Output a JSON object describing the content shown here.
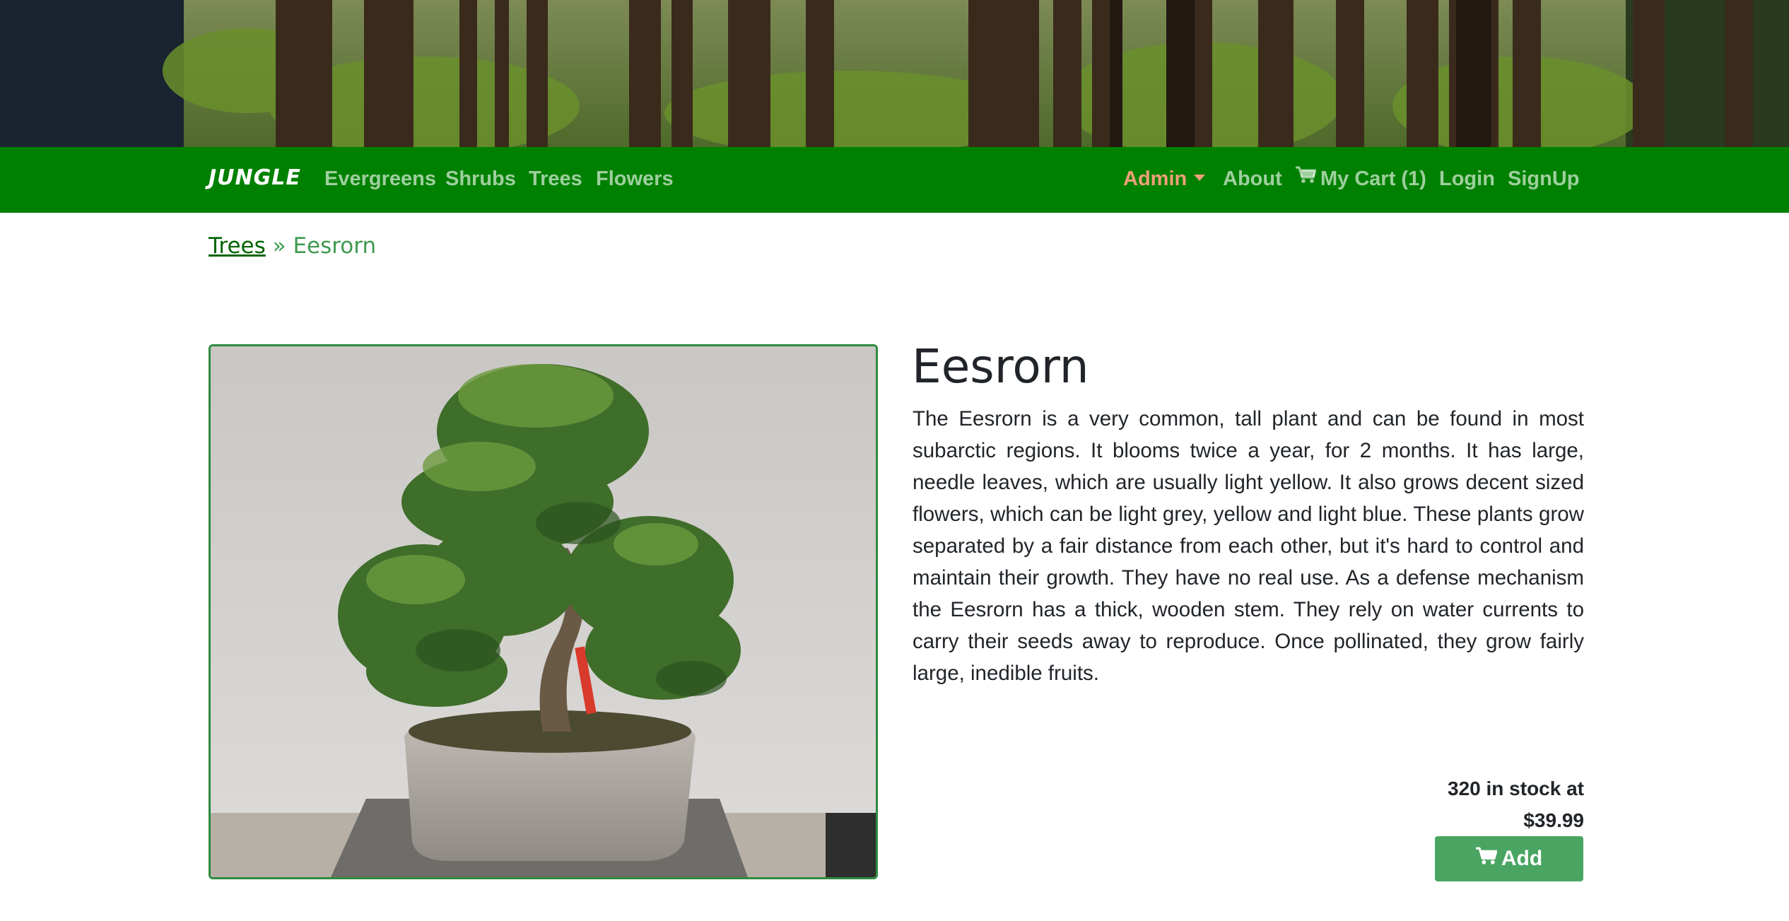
{
  "navbar": {
    "brand": "JUNGLE",
    "left_links": [
      "Evergreens",
      "Shrubs",
      "Trees",
      "Flowers"
    ],
    "admin_label": "Admin",
    "about_label": "About",
    "cart_label": "My Cart (1)",
    "login_label": "Login",
    "signup_label": "SignUp"
  },
  "breadcrumb": {
    "parent": "Trees",
    "separator": "»",
    "current": "Eesrorn"
  },
  "product": {
    "name": "Eesrorn",
    "description": "The Eesrorn is a very common, tall plant and can be found in most subarctic regions. It blooms twice a year, for 2 months. It has large, needle leaves, which are usually light yellow. It also grows decent sized flowers, which can be light grey, yellow and light blue. These plants grow separated by a fair distance from each other, but it's hard to control and maintain their growth. They have no real use. As a defense mechanism the Eesrorn has a thick, wooden stem. They rely on water currents to carry their seeds away to reproduce. Once pollinated, they grow fairly large, inedible fruits.",
    "stock_text": "320 in stock at",
    "price": "$39.99",
    "add_label": "Add"
  },
  "icons": {
    "cart": "shopping-cart-icon",
    "caret": "caret-down-icon"
  },
  "colors": {
    "navbar_bg": "#008000",
    "admin_link": "#f0a07a",
    "add_button": "#4aa562",
    "image_border": "#2e8b3e"
  }
}
